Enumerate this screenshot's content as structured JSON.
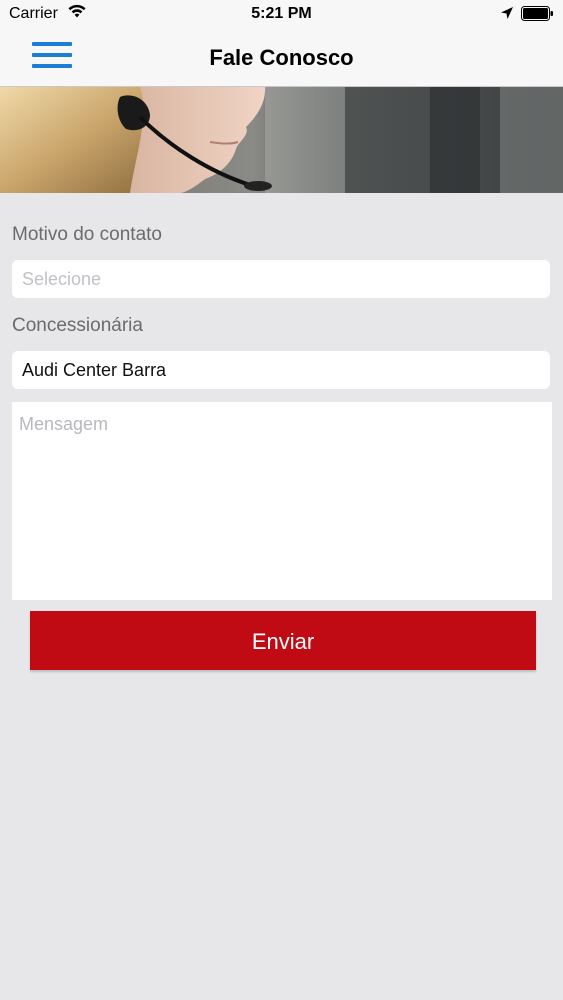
{
  "status_bar": {
    "carrier": "Carrier",
    "time": "5:21 PM",
    "icons": [
      "wifi-icon",
      "location-arrow-icon",
      "battery-icon"
    ]
  },
  "nav": {
    "title": "Fale Conosco",
    "menu_icon": "hamburger-menu-icon"
  },
  "banner": {
    "description_icon": "support-agent-headset-photo"
  },
  "form": {
    "motivo_label": "Motivo do contato",
    "motivo_placeholder": "Selecione",
    "concessionaria_label": "Concessionária",
    "concessionaria_value": "Audi Center Barra",
    "mensagem_placeholder": "Mensagem",
    "submit_label": "Enviar"
  },
  "colors": {
    "accent_blue": "#1a7ed6",
    "submit_red": "#c00a14",
    "background": "#e7e7e9"
  }
}
